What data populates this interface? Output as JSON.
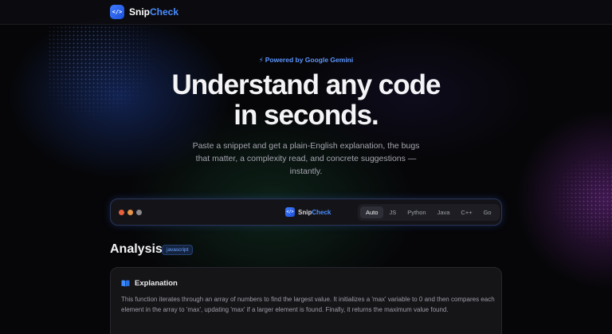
{
  "nav": {
    "logo_glyph": "</>",
    "brand_main": "Snip",
    "brand_accent": "Check"
  },
  "hero": {
    "badge": "Powered by Google Gemini",
    "title_line1": "Understand any code",
    "title_line2": "in seconds.",
    "subtitle": "Paste a snippet and get a plain-English explanation, the bugs that matter, a complexity read, and concrete suggestions — instantly."
  },
  "editor_toolbar": {
    "logo_glyph": "</>",
    "brand_main": "Snip",
    "brand_accent": "Check",
    "languages": [
      "Auto",
      "JS",
      "Python",
      "Java",
      "C++",
      "Go"
    ],
    "active_language": "Auto"
  },
  "analysis": {
    "heading": "Analysis",
    "language_tag": "javascript",
    "explanation": {
      "icon": "book-icon",
      "title": "Explanation",
      "body": "This function iterates through an array of numbers to find the largest value. It initializes a 'max' variable to 0 and then compares each element in the array to 'max', updating 'max' if a larger element is found. Finally, it returns the maximum value found."
    }
  },
  "colors": {
    "accent": "#4a8dff",
    "background": "#060608",
    "traffic_red": "#e8613c",
    "traffic_orange": "#e8954a",
    "traffic_gray": "#8a8a8f"
  }
}
